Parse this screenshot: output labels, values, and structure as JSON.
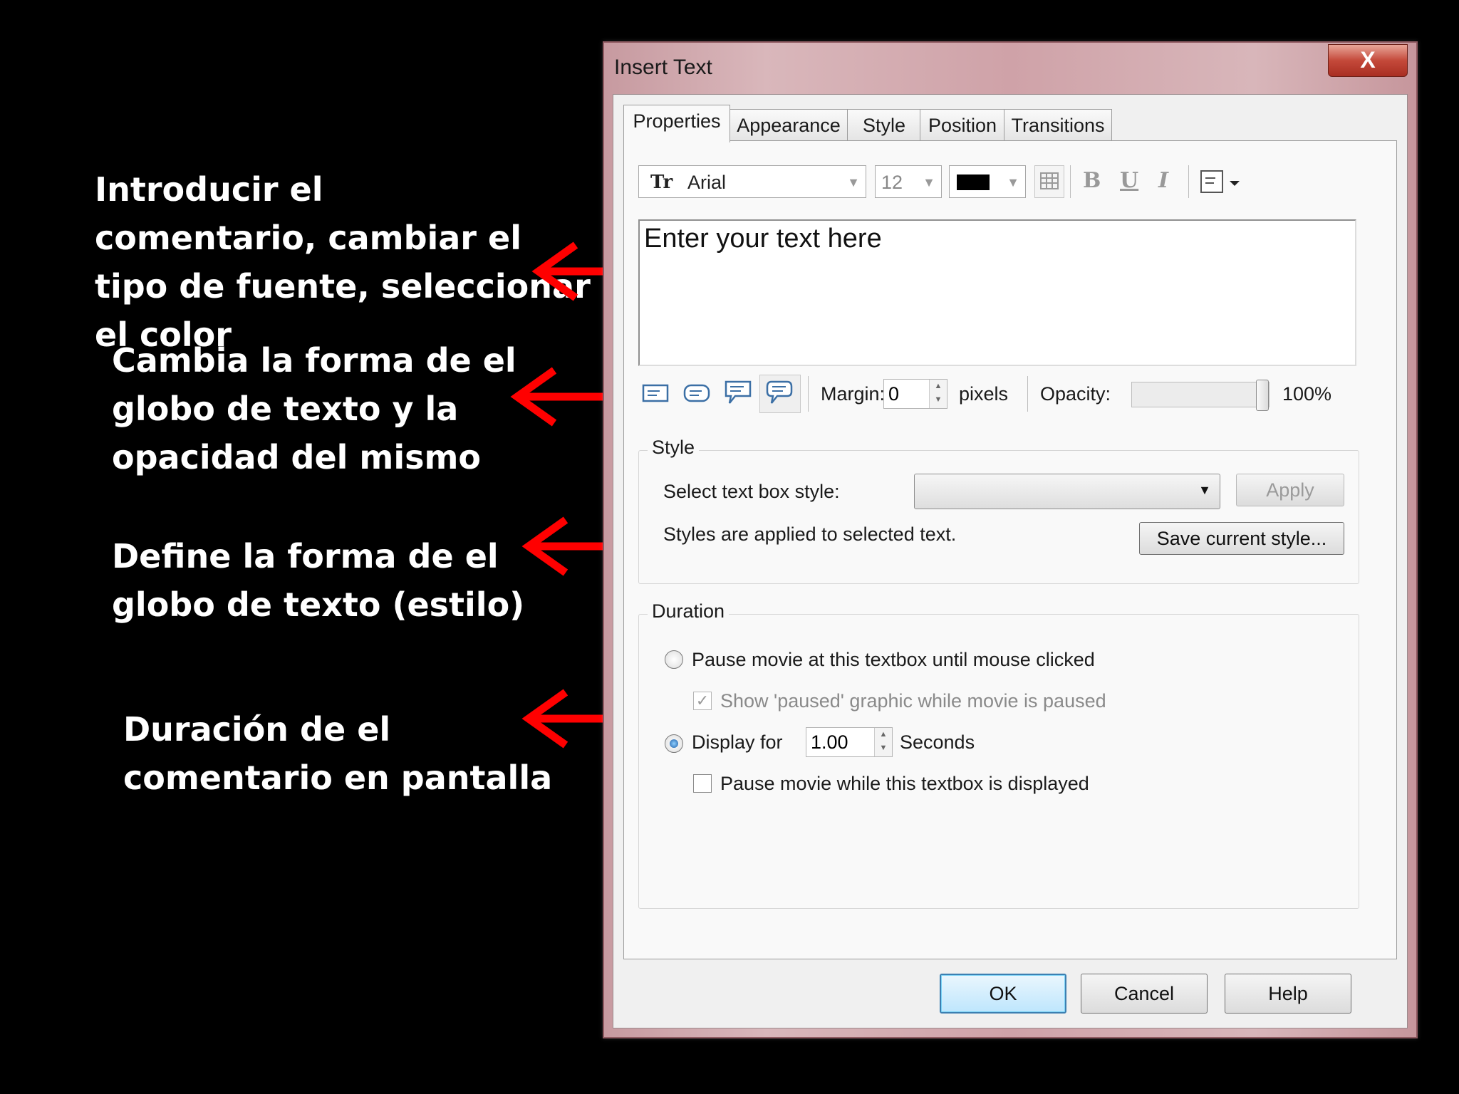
{
  "annotations": [
    "Introducir el\ncomentario, cambiar el\ntipo de fuente, seleccionar\nel color",
    "Cambia la forma de el\nglobo de texto y la\nopacidad del mismo",
    "Define la forma de el\nglobo de texto (estilo)",
    "Duración de el\ncomentario en pantalla"
  ],
  "dialog": {
    "title": "Insert Text",
    "close_glyph": "X",
    "tabs": [
      "Properties",
      "Appearance",
      "Style",
      "Position",
      "Transitions"
    ],
    "toolbar": {
      "font": "Arial",
      "font_icon": "Tr",
      "size": "12",
      "color": "#000000",
      "bold": "B",
      "underline": "U",
      "italic": "I"
    },
    "text_area": {
      "placeholder": "Enter your text here"
    },
    "shape_row": {
      "margin_label": "Margin:",
      "margin_value": "0",
      "margin_unit": "pixels",
      "opacity_label": "Opacity:",
      "opacity_value": "100%",
      "opacity_level": 1.0
    },
    "style_group": {
      "title": "Style",
      "select_label": "Select text box style:",
      "select_value": "",
      "apply": "Apply",
      "note": "Styles are applied to selected text.",
      "save": "Save current style..."
    },
    "duration_group": {
      "title": "Duration",
      "pause_option": "Pause movie at this textbox until mouse clicked",
      "show_paused": "Show 'paused' graphic while movie is paused",
      "display_for": "Display for",
      "display_value": "1.00",
      "seconds": "Seconds",
      "pause_while": "Pause movie while this textbox is displayed"
    },
    "buttons": {
      "ok": "OK",
      "cancel": "Cancel",
      "help": "Help"
    }
  },
  "colors": {
    "arrow": "#ff0000",
    "text": "#ffffff",
    "background": "#000000"
  }
}
